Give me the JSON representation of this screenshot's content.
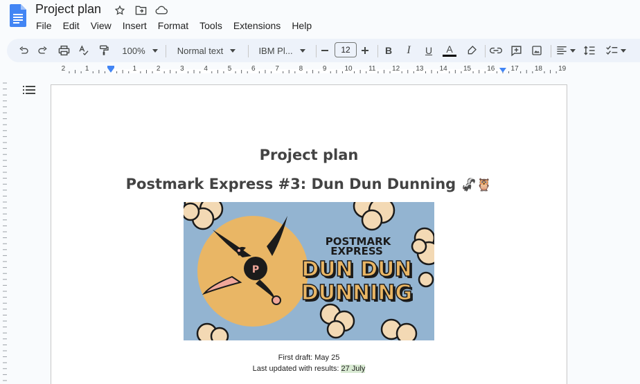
{
  "app": {
    "title": "Project plan",
    "menu": [
      "File",
      "Edit",
      "View",
      "Insert",
      "Format",
      "Tools",
      "Extensions",
      "Help"
    ]
  },
  "toolbar": {
    "zoom": "100%",
    "style": "Normal text",
    "font": "IBM Pl...",
    "font_size": "12",
    "bold_label": "B",
    "italic_label": "I",
    "underline_label": "U",
    "text_color_label": "A"
  },
  "ruler": {
    "labels": [
      "2",
      "1",
      "1",
      "2",
      "3",
      "4",
      "5",
      "6",
      "7",
      "8",
      "9",
      "10",
      "11",
      "12",
      "13",
      "14",
      "15",
      "16",
      "17",
      "18",
      "19"
    ]
  },
  "document": {
    "title": "Project plan",
    "subtitle": "Postmark Express #3: Dun Dun Dunning",
    "subtitle_emoji": "🦨🦉",
    "banner": {
      "brand_line1": "POSTMARK",
      "brand_line2": "EXPRESS",
      "headline_line1": "DUN DUN",
      "headline_line2": "DUNNING",
      "badge_letter": "P"
    },
    "first_draft": "First draft: May 25",
    "last_updated_label": "Last updated with results: ",
    "last_updated_value": "27 July"
  },
  "colors": {
    "accent_blue": "#4285f4",
    "toolbar_bg": "#edf2fa",
    "banner_bg": "#93b4d1",
    "sun": "#e9b665",
    "cloud": "#f3d9b4",
    "highlight": "#d9ead3"
  },
  "icons": [
    "docs-logo-icon",
    "star-icon",
    "move-folder-icon",
    "cloud-saved-icon",
    "undo-icon",
    "redo-icon",
    "print-icon",
    "spellcheck-icon",
    "paint-format-icon",
    "minus-icon",
    "plus-icon",
    "highlighter-icon",
    "link-icon",
    "add-comment-icon",
    "insert-image-icon",
    "align-icon",
    "line-spacing-icon",
    "checklist-icon",
    "outline-icon"
  ]
}
